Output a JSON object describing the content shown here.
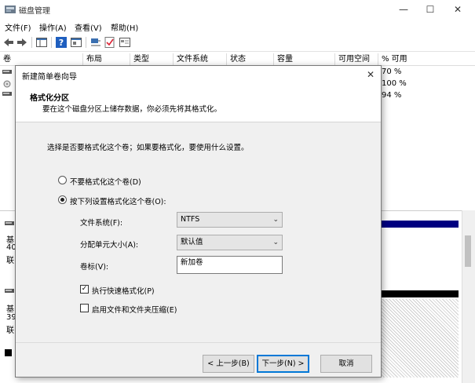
{
  "window": {
    "title": "磁盘管理",
    "menu": [
      "文件(F)",
      "操作(A)",
      "查看(V)",
      "帮助(H)"
    ]
  },
  "grid": {
    "columns": [
      "卷",
      "布局",
      "类型",
      "文件系统",
      "状态",
      "容量",
      "可用空间",
      "% 可用"
    ],
    "percent_values": [
      "70 %",
      "100 %",
      "94 %"
    ]
  },
  "lower_labels": {
    "disk0": [
      "基",
      "40",
      "联"
    ],
    "disk1": [
      "基",
      "39",
      "联"
    ]
  },
  "dialog": {
    "title": "新建简单卷向导",
    "header_title": "格式化分区",
    "header_subtitle": "要在这个磁盘分区上储存数据，你必须先将其格式化。",
    "prompt": "选择是否要格式化这个卷；如果要格式化，要使用什么设置。",
    "radio_no_format": "不要格式化这个卷(D)",
    "radio_format": "按下列设置格式化这个卷(O):",
    "fs_label": "文件系统(F):",
    "fs_value": "NTFS",
    "alloc_label": "分配单元大小(A):",
    "alloc_value": "默认值",
    "volume_label": "卷标(V):",
    "volume_value": "新加卷",
    "quick_format": "执行快速格式化(P)",
    "compression": "启用文件和文件夹压缩(E)",
    "btn_back": "< 上一步(B)",
    "btn_next": "下一步(N) >",
    "btn_cancel": "取消"
  },
  "colors": {
    "accent": "#0078d7",
    "disk_bar_blue": "#000080",
    "disk_bar_black": "#000000"
  }
}
